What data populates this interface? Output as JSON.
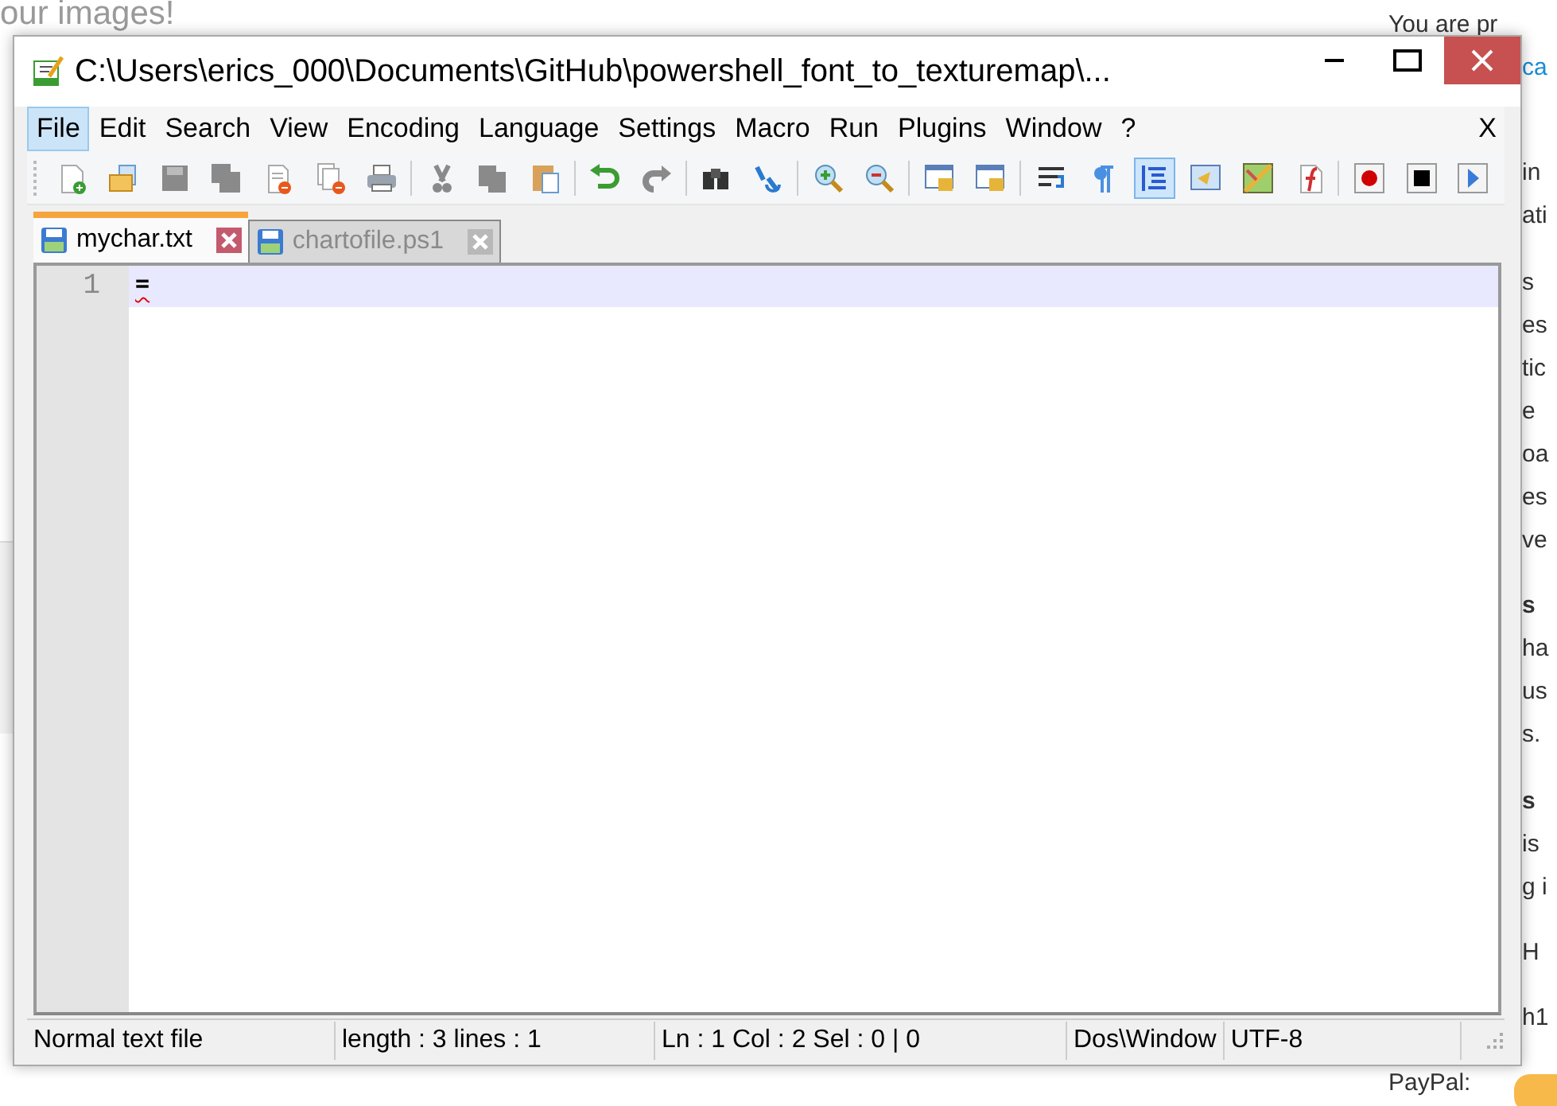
{
  "background_page": {
    "heading": "our images!",
    "right_fragments": [
      {
        "text": "You  are  pr",
        "kind": "plain"
      },
      {
        "text": "ca",
        "kind": "link"
      },
      {
        "text": "in",
        "kind": "plain"
      },
      {
        "text": "ati",
        "kind": "plain"
      },
      {
        "text": "s",
        "kind": "plain"
      },
      {
        "text": "es",
        "kind": "plain"
      },
      {
        "text": "tic",
        "kind": "plain"
      },
      {
        "text": "e",
        "kind": "plain"
      },
      {
        "text": "oa",
        "kind": "plain"
      },
      {
        "text": "es",
        "kind": "plain"
      },
      {
        "text": "ve",
        "kind": "plain"
      },
      {
        "text": "s",
        "kind": "bold"
      },
      {
        "text": "ha",
        "kind": "plain"
      },
      {
        "text": "us",
        "kind": "plain"
      },
      {
        "text": "s.",
        "kind": "plain"
      },
      {
        "text": "s",
        "kind": "bold"
      },
      {
        "text": "is",
        "kind": "plain"
      },
      {
        "text": "g i",
        "kind": "plain"
      },
      {
        "text": "H",
        "kind": "plain"
      },
      {
        "text": "h1",
        "kind": "plain"
      },
      {
        "text": "PayPal:",
        "kind": "plain"
      }
    ]
  },
  "window": {
    "title": "C:\\Users\\erics_000\\Documents\\GitHub\\powershell_font_to_texturemap\\...",
    "close_doc": "X"
  },
  "menu": [
    {
      "label": "File",
      "selected": true
    },
    {
      "label": "Edit",
      "selected": false
    },
    {
      "label": "Search",
      "selected": false
    },
    {
      "label": "View",
      "selected": false
    },
    {
      "label": "Encoding",
      "selected": false
    },
    {
      "label": "Language",
      "selected": false
    },
    {
      "label": "Settings",
      "selected": false
    },
    {
      "label": "Macro",
      "selected": false
    },
    {
      "label": "Run",
      "selected": false
    },
    {
      "label": "Plugins",
      "selected": false
    },
    {
      "label": "Window",
      "selected": false
    },
    {
      "label": "?",
      "selected": false
    }
  ],
  "toolbar": [
    {
      "kind": "new",
      "selected": false
    },
    {
      "kind": "open",
      "selected": false
    },
    {
      "kind": "save",
      "selected": false
    },
    {
      "kind": "saveall",
      "selected": false
    },
    {
      "kind": "close",
      "selected": false
    },
    {
      "kind": "closeall",
      "selected": false
    },
    {
      "kind": "print",
      "selected": false
    },
    {
      "kind": "sep"
    },
    {
      "kind": "cut",
      "selected": false
    },
    {
      "kind": "copy",
      "selected": false
    },
    {
      "kind": "paste",
      "selected": false
    },
    {
      "kind": "sep"
    },
    {
      "kind": "undo",
      "selected": false
    },
    {
      "kind": "redo",
      "selected": false
    },
    {
      "kind": "sep"
    },
    {
      "kind": "find",
      "selected": false
    },
    {
      "kind": "replace",
      "selected": false
    },
    {
      "kind": "sep"
    },
    {
      "kind": "zoomin",
      "selected": false
    },
    {
      "kind": "zoomout",
      "selected": false
    },
    {
      "kind": "sep"
    },
    {
      "kind": "syncv",
      "selected": false
    },
    {
      "kind": "synch",
      "selected": false
    },
    {
      "kind": "sep"
    },
    {
      "kind": "wrap",
      "selected": false
    },
    {
      "kind": "pilcrow",
      "selected": false
    },
    {
      "kind": "indent",
      "selected": true
    },
    {
      "kind": "lang",
      "selected": false
    },
    {
      "kind": "map",
      "selected": false
    },
    {
      "kind": "func",
      "selected": false
    },
    {
      "kind": "sep"
    },
    {
      "kind": "record",
      "selected": false
    },
    {
      "kind": "stop",
      "selected": false
    },
    {
      "kind": "play",
      "selected": false
    }
  ],
  "tabs": [
    {
      "label": "mychar.txt",
      "selected": true
    },
    {
      "label": "chartofile.ps1",
      "selected": false
    }
  ],
  "editor": {
    "lines": [
      {
        "number": "1",
        "text": "=",
        "current": true,
        "misspelled": true
      }
    ]
  },
  "status_bar": [
    "Normal text file",
    "length : 3    lines : 1",
    "Ln : 1    Col : 2    Sel : 0 | 0",
    "Dos\\Window",
    "UTF-8"
  ]
}
